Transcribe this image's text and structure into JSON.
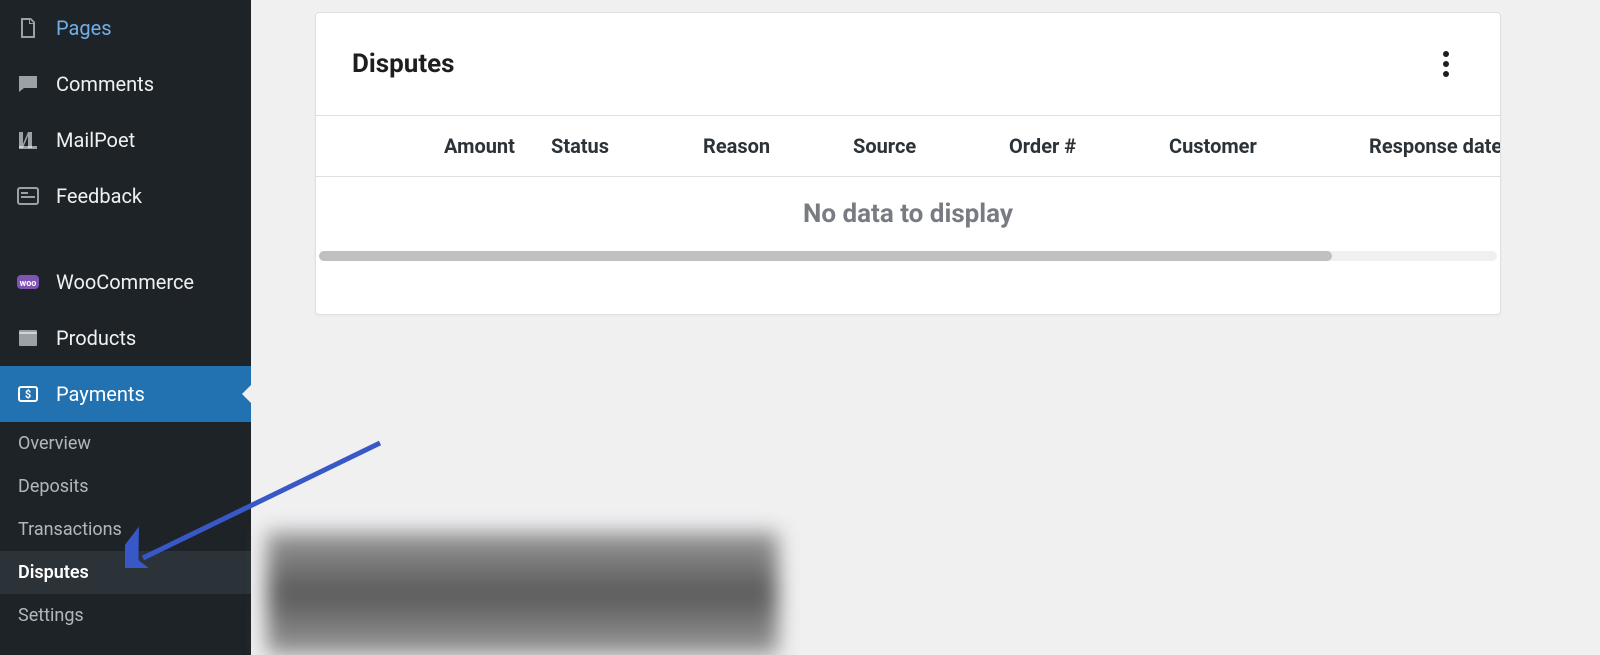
{
  "sidebar": {
    "items": [
      {
        "label": "Pages",
        "icon": "pages"
      },
      {
        "label": "Comments",
        "icon": "comment"
      },
      {
        "label": "MailPoet",
        "icon": "mailpoet"
      },
      {
        "label": "Feedback",
        "icon": "feedback"
      },
      {
        "label": "WooCommerce",
        "icon": "woo"
      },
      {
        "label": "Products",
        "icon": "products"
      },
      {
        "label": "Payments",
        "icon": "payments"
      }
    ],
    "payments_sub": [
      {
        "label": "Overview"
      },
      {
        "label": "Deposits"
      },
      {
        "label": "Transactions"
      },
      {
        "label": "Disputes"
      },
      {
        "label": "Settings"
      }
    ]
  },
  "card": {
    "title": "Disputes",
    "columns": {
      "amount": "Amount",
      "status": "Status",
      "reason": "Reason",
      "source": "Source",
      "order": "Order #",
      "customer": "Customer",
      "response_date": "Response date"
    },
    "empty_message": "No data to display"
  }
}
